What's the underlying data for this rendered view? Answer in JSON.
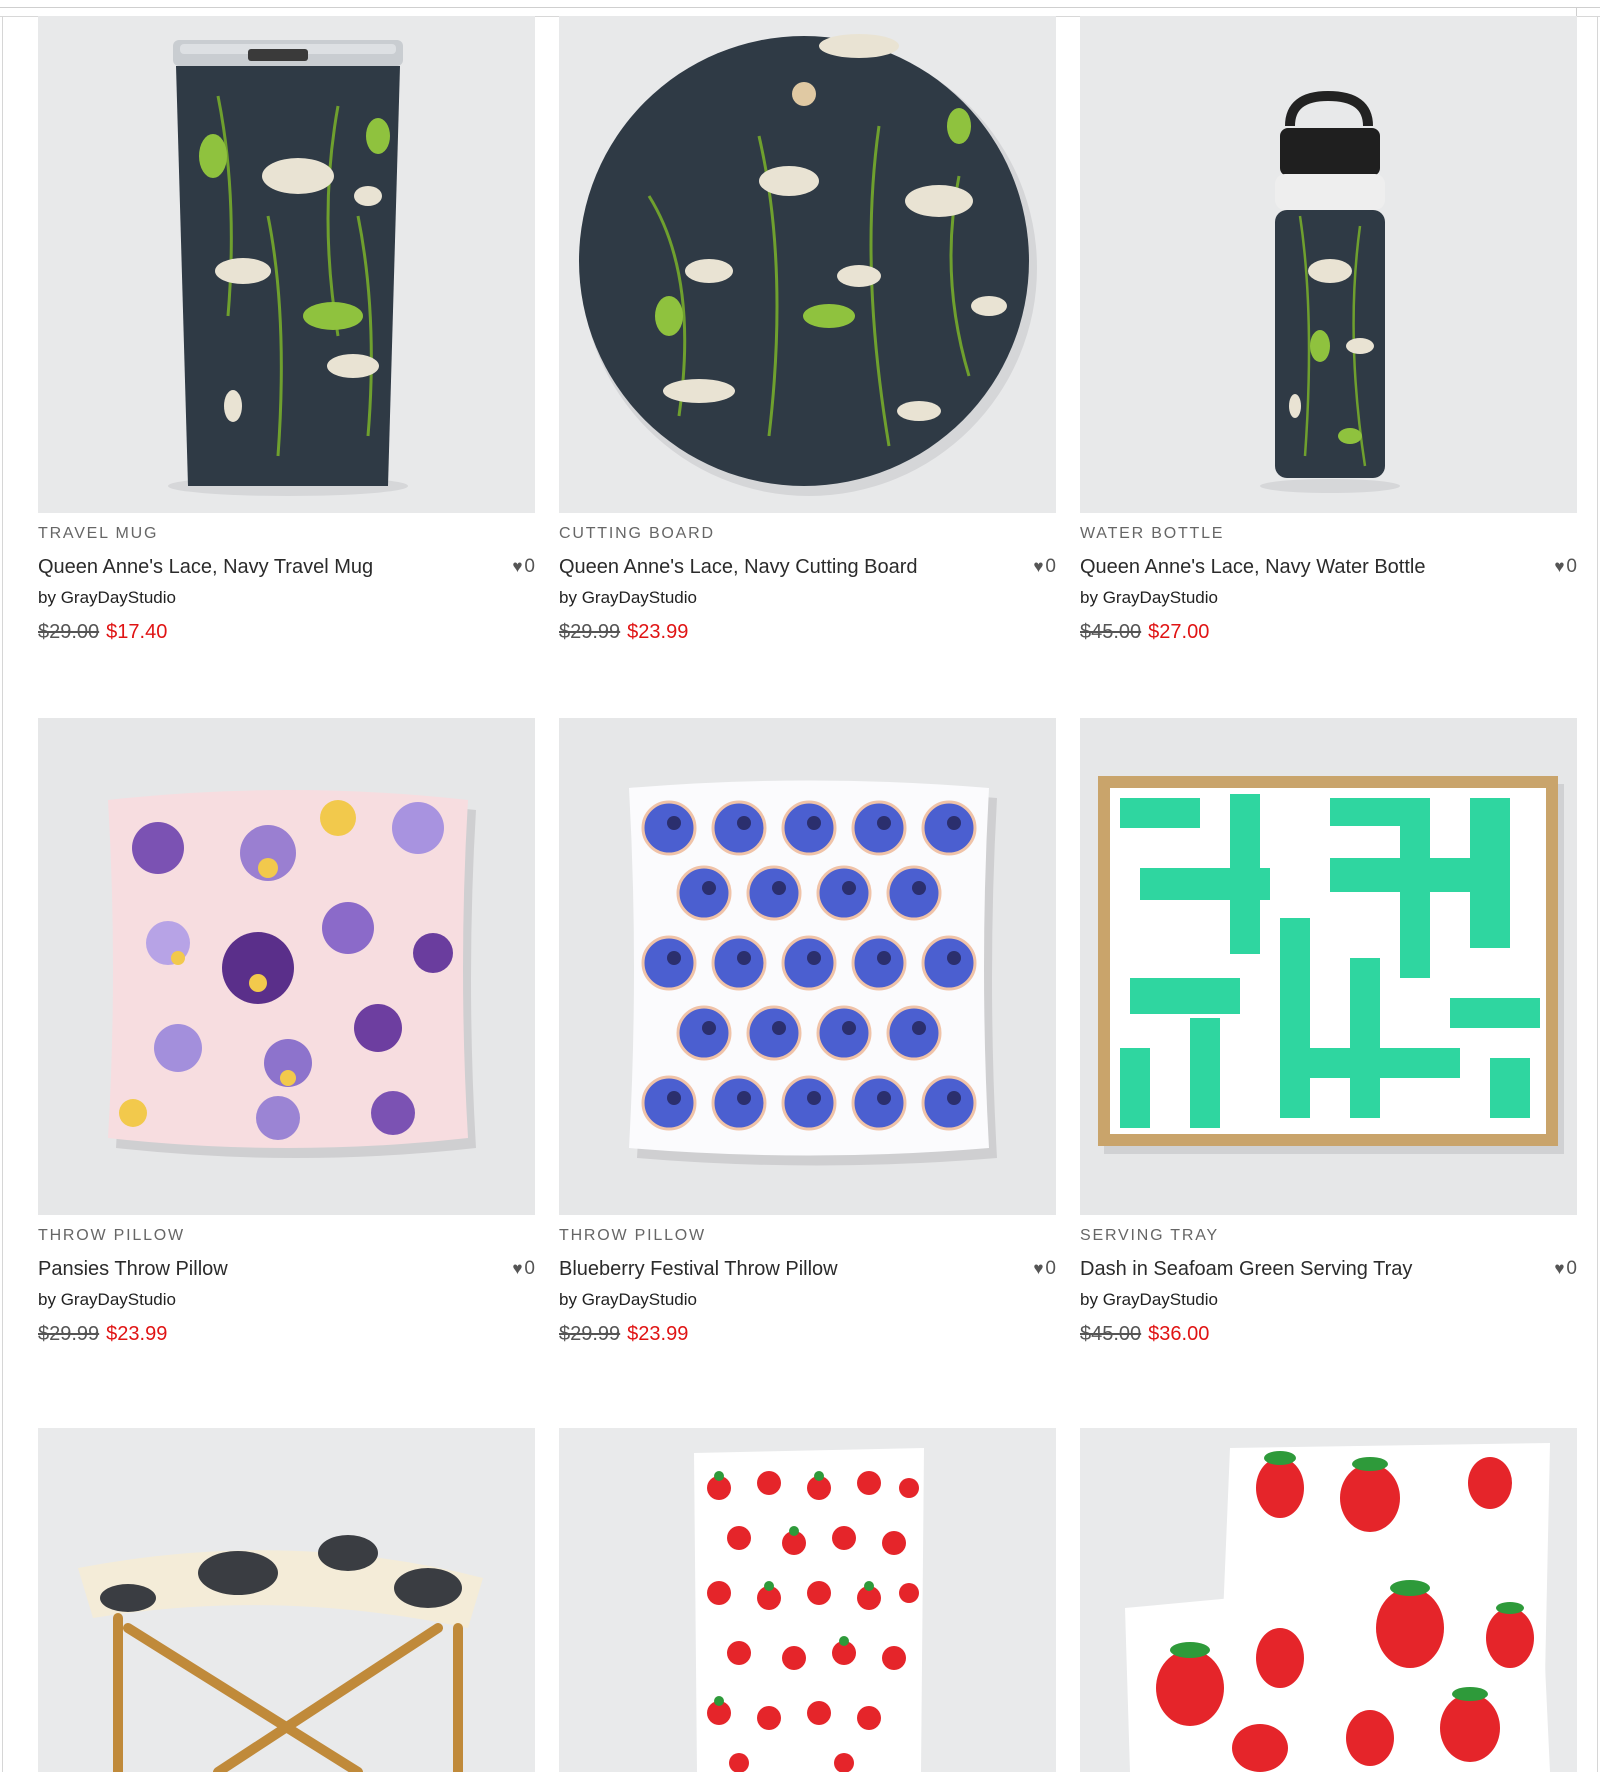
{
  "by_prefix": "by",
  "products": [
    {
      "category": "TRAVEL MUG",
      "title": "Queen Anne's Lace, Navy Travel Mug",
      "artist": "GrayDayStudio",
      "old_price": "$29.00",
      "new_price": "$17.40",
      "likes": "0"
    },
    {
      "category": "CUTTING BOARD",
      "title": "Queen Anne's Lace, Navy Cutting Board",
      "artist": "GrayDayStudio",
      "old_price": "$29.99",
      "new_price": "$23.99",
      "likes": "0"
    },
    {
      "category": "WATER BOTTLE",
      "title": "Queen Anne's Lace, Navy Water Bottle",
      "artist": "GrayDayStudio",
      "old_price": "$45.00",
      "new_price": "$27.00",
      "likes": "0"
    },
    {
      "category": "THROW PILLOW",
      "title": "Pansies Throw Pillow",
      "artist": "GrayDayStudio",
      "old_price": "$29.99",
      "new_price": "$23.99",
      "likes": "0"
    },
    {
      "category": "THROW PILLOW",
      "title": "Blueberry Festival Throw Pillow",
      "artist": "GrayDayStudio",
      "old_price": "$29.99",
      "new_price": "$23.99",
      "likes": "0"
    },
    {
      "category": "SERVING TRAY",
      "title": "Dash in Seafoam Green Serving Tray",
      "artist": "GrayDayStudio",
      "old_price": "$45.00",
      "new_price": "$36.00",
      "likes": "0"
    }
  ],
  "colors": {
    "sale_price": "#e01414",
    "navy_pattern": "#2f3a45",
    "seafoam": "#2fd6a0",
    "pansy_bg": "#f7dde0"
  },
  "icons": {
    "like": "heart-icon"
  }
}
